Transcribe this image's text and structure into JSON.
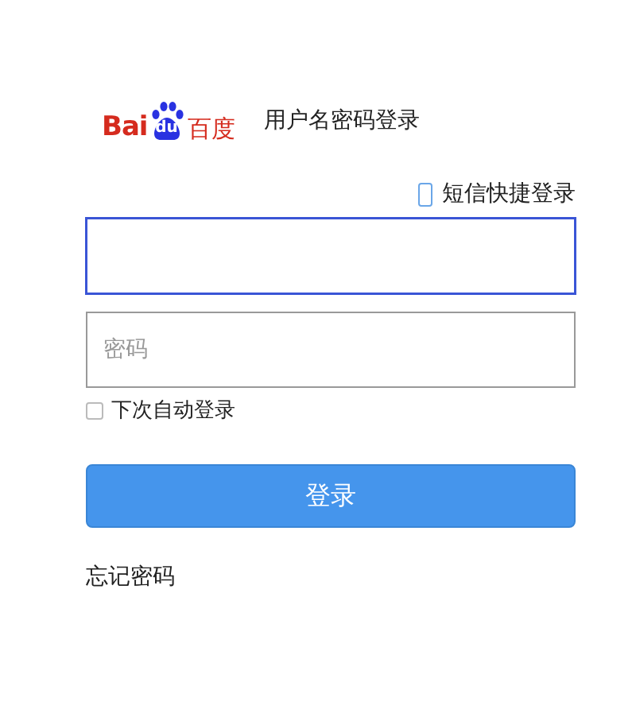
{
  "header": {
    "logo": {
      "latin_1": "Bai",
      "latin_2": "du",
      "chinese": "百度"
    },
    "title": "用户名密码登录"
  },
  "sms_login_link": "短信快捷登录",
  "fields": [
    {
      "focused": true
    },
    {
      "placeholder": "密码",
      "focused": false
    }
  ],
  "remember": {
    "label": "下次自动登录",
    "checked": false
  },
  "login_button": "登录",
  "forgot_password_link": "忘记密码"
}
